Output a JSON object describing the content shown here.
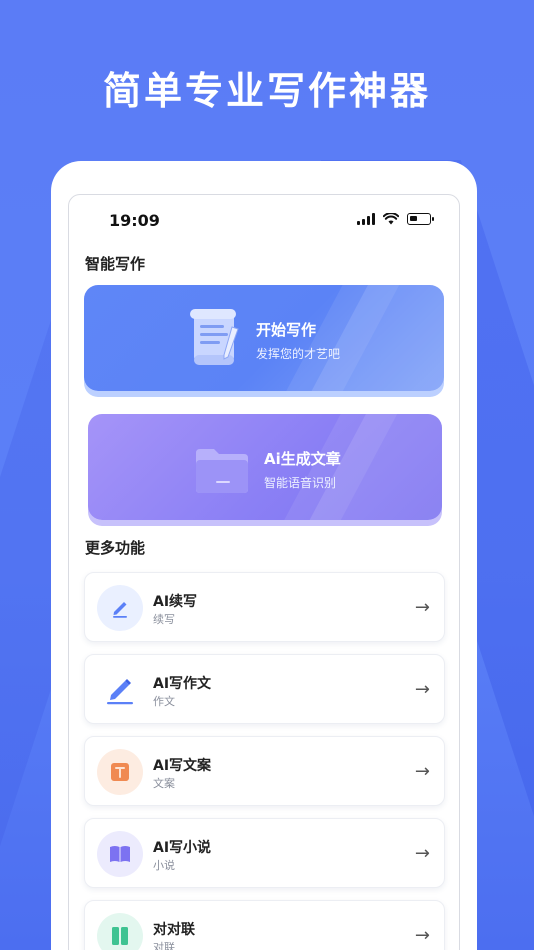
{
  "headline": "简单专业写作神器",
  "status_bar": {
    "time": "19:09"
  },
  "smart_writing": {
    "title": "智能写作",
    "cards": [
      {
        "title": "开始写作",
        "subtitle": "发挥您的才艺吧",
        "icon": "scroll-pen-icon"
      },
      {
        "title": "Ai生成文章",
        "subtitle": "智能语音识别",
        "icon": "folder-icon"
      }
    ]
  },
  "more_features": {
    "title": "更多功能",
    "items": [
      {
        "title": "AI续写",
        "subtitle": "续写",
        "icon": "pen-icon",
        "icon_bg": "#eaf0ff"
      },
      {
        "title": "AI写作文",
        "subtitle": "作文",
        "icon": "pen-line-icon",
        "icon_bg": "#ffffff"
      },
      {
        "title": "AI写文案",
        "subtitle": "文案",
        "icon": "text-doc-icon",
        "icon_bg": "#fdece1"
      },
      {
        "title": "AI写小说",
        "subtitle": "小说",
        "icon": "book-icon",
        "icon_bg": "#ecebfd"
      },
      {
        "title": "对对联",
        "subtitle": "对联",
        "icon": "couplet-icon",
        "icon_bg": "#e3f7ef"
      }
    ],
    "arrow": "→"
  },
  "colors": {
    "accent_blue": "#5b80f7",
    "accent_purple": "#8b80f5"
  }
}
